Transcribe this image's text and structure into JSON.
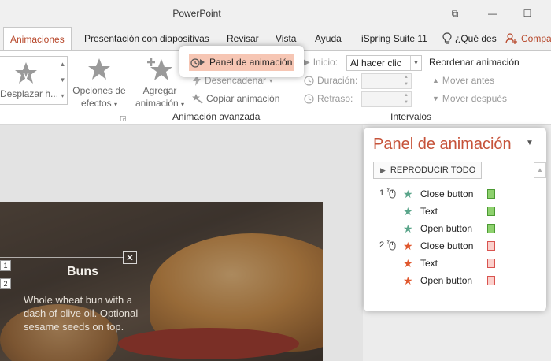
{
  "window": {
    "title": "PowerPoint",
    "restore_glyph": "⧉",
    "minimize_glyph": "—",
    "maximize_glyph": "☐"
  },
  "tabs": [
    {
      "label": "Animaciones",
      "active": true
    },
    {
      "label": "Presentación con diapositivas"
    },
    {
      "label": "Revisar"
    },
    {
      "label": "Vista"
    },
    {
      "label": "Ayuda"
    },
    {
      "label": "iSpring Suite 11"
    },
    {
      "label": "¿Qué des"
    },
    {
      "label": "Compa"
    }
  ],
  "ribbon": {
    "gallery_item": "Desplazar h...",
    "effect_options": "Opciones de",
    "effect_options_2": "efectos",
    "add_animation": "Agregar",
    "add_animation_2": "animación",
    "animation_pane": "Panel de animación",
    "trigger": "Desencadenar",
    "copy_animation": "Copiar animación",
    "group_advanced": "Animación avanzada",
    "start_label": "Inicio:",
    "start_value": "Al hacer clic",
    "duration_label": "Duración:",
    "delay_label": "Retraso:",
    "group_timing": "Intervalos",
    "reorder_title": "Reordenar animación",
    "move_earlier": "Mover antes",
    "move_later": "Mover después"
  },
  "slide": {
    "title": "Buns",
    "description": "Whole wheat bun with a dash of olive oil. Optional sesame seeds on top.",
    "num1": "1",
    "num2": "2",
    "close_glyph": "✕"
  },
  "anim_panel": {
    "title": "Panel de animación",
    "play_all": "REPRODUCIR TODO",
    "items": [
      {
        "seq": "1",
        "label": "Close button",
        "star_color": "#5aa58a",
        "bar_fill": "#8ed16e",
        "bar_border": "#4c9a33"
      },
      {
        "seq": "",
        "label": "Text",
        "star_color": "#5aa58a",
        "bar_fill": "#8ed16e",
        "bar_border": "#4c9a33"
      },
      {
        "seq": "",
        "label": "Open button",
        "star_color": "#5aa58a",
        "bar_fill": "#8ed16e",
        "bar_border": "#4c9a33"
      },
      {
        "seq": "2",
        "label": "Close button",
        "star_color": "#e0572d",
        "bar_fill": "#fbd0cc",
        "bar_border": "#d9534f"
      },
      {
        "seq": "",
        "label": "Text",
        "star_color": "#e0572d",
        "bar_fill": "#fbd0cc",
        "bar_border": "#d9534f"
      },
      {
        "seq": "",
        "label": "Open button",
        "star_color": "#e0572d",
        "bar_fill": "#fbd0cc",
        "bar_border": "#d9534f"
      }
    ]
  },
  "colors": {
    "accent": "#c6533a",
    "tab_active": "#b7472a",
    "highlight": "#f6c6b4"
  }
}
